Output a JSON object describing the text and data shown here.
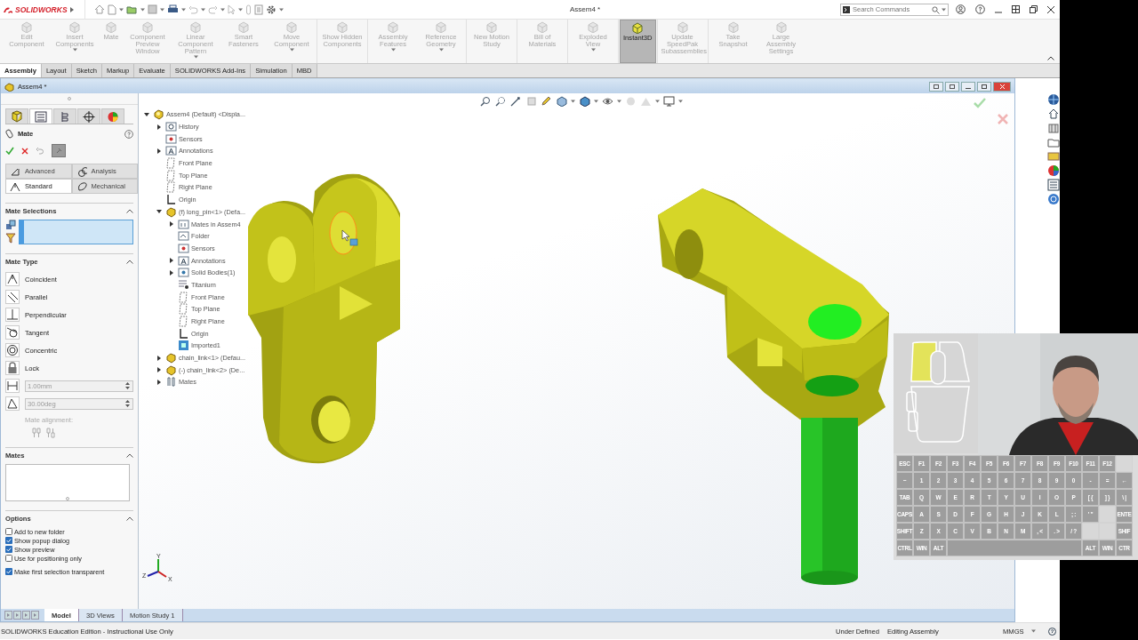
{
  "title_bar": {
    "logo": "SOLIDWORKS",
    "title": "Assem4 *",
    "search": {
      "placeholder": "Search Commands"
    }
  },
  "ribbon": [
    [
      {
        "label": "Edit Component",
        "disabled": true,
        "selected": false,
        "dropdown": false
      },
      {
        "label": "Insert Components",
        "disabled": true,
        "selected": false,
        "dropdown": true
      },
      {
        "label": "Mate",
        "disabled": true,
        "selected": false,
        "dropdown": false
      },
      {
        "label": "Component Preview Window",
        "disabled": true,
        "selected": false,
        "dropdown": false
      },
      {
        "label": "Linear Component Pattern",
        "disabled": true,
        "selected": false,
        "dropdown": true
      },
      {
        "label": "Smart Fasteners",
        "disabled": true,
        "selected": false,
        "dropdown": false
      },
      {
        "label": "Move Component",
        "disabled": true,
        "selected": false,
        "dropdown": true
      }
    ],
    [
      {
        "label": "Show Hidden Components",
        "disabled": true,
        "selected": false,
        "dropdown": false
      }
    ],
    [
      {
        "label": "Assembly Features",
        "disabled": true,
        "selected": false,
        "dropdown": true
      },
      {
        "label": "Reference Geometry",
        "disabled": true,
        "selected": false,
        "dropdown": true
      }
    ],
    [
      {
        "label": "New Motion Study",
        "disabled": true,
        "selected": false,
        "dropdown": false
      }
    ],
    [
      {
        "label": "Bill of Materials",
        "disabled": true,
        "selected": false,
        "dropdown": false
      }
    ],
    [
      {
        "label": "Exploded View",
        "disabled": true,
        "selected": false,
        "dropdown": true
      }
    ],
    [
      {
        "label": "Instant3D",
        "disabled": false,
        "selected": true,
        "dropdown": false
      }
    ],
    [
      {
        "label": "Update SpeedPak Subassemblies",
        "disabled": true,
        "selected": false,
        "dropdown": false
      }
    ],
    [
      {
        "label": "Take Snapshot",
        "disabled": true,
        "selected": false,
        "dropdown": false
      },
      {
        "label": "Large Assembly Settings",
        "disabled": true,
        "selected": false,
        "dropdown": false
      }
    ]
  ],
  "command_tabs": [
    {
      "label": "Assembly",
      "selected": true
    },
    {
      "label": "Layout",
      "selected": false
    },
    {
      "label": "Sketch",
      "selected": false
    },
    {
      "label": "Markup",
      "selected": false
    },
    {
      "label": "Evaluate",
      "selected": false
    },
    {
      "label": "SOLIDWORKS Add-Ins",
      "selected": false
    },
    {
      "label": "Simulation",
      "selected": false
    },
    {
      "label": "MBD",
      "selected": false
    }
  ],
  "document": {
    "title": "Assem4 *"
  },
  "property_manager": {
    "panel_tabs": [
      {
        "kind": "feature-tree",
        "selected": false
      },
      {
        "kind": "property",
        "selected": true
      },
      {
        "kind": "configuration",
        "selected": false
      },
      {
        "kind": "dimxpert",
        "selected": false
      },
      {
        "kind": "display",
        "selected": false
      }
    ],
    "title": "Mate",
    "mode_tabs": [
      {
        "label": "Advanced",
        "kind": "advanced",
        "selected": false
      },
      {
        "label": "Analysis",
        "kind": "analysis",
        "selected": false
      },
      {
        "label": "Standard",
        "kind": "standard",
        "selected": true
      },
      {
        "label": "Mechanical",
        "kind": "mechanical",
        "selected": false
      }
    ],
    "mate_selections": {
      "heading": "Mate Selections",
      "focused": true
    },
    "mate_type": {
      "heading": "Mate Type",
      "items": [
        {
          "label": "Coincident",
          "kind": "coincident"
        },
        {
          "label": "Parallel",
          "kind": "parallel"
        },
        {
          "label": "Perpendicular",
          "kind": "perpendicular"
        },
        {
          "label": "Tangent",
          "kind": "tangent"
        },
        {
          "label": "Concentric",
          "kind": "concentric"
        },
        {
          "label": "Lock",
          "kind": "lock"
        }
      ],
      "distance": {
        "value": "1.00mm",
        "disabled": true
      },
      "angle": {
        "value": "30.00deg",
        "disabled": true
      },
      "alignment_label": "Mate alignment:"
    },
    "mates": {
      "heading": "Mates"
    },
    "options": {
      "heading": "Options",
      "items": [
        {
          "label": "Add to new folder",
          "checked": false
        },
        {
          "label": "Show popup dialog",
          "checked": true
        },
        {
          "label": "Show preview",
          "checked": true
        },
        {
          "label": "Use for positioning only",
          "checked": false
        },
        {
          "label": "Make first selection transparent",
          "checked": true
        }
      ]
    }
  },
  "tree": [
    {
      "label": "Assem4 (Default) <Displa...",
      "kind": "assembly",
      "expanded": true,
      "children": [
        {
          "label": "History",
          "kind": "history",
          "expanded": false
        },
        {
          "label": "Sensors",
          "kind": "sensor"
        },
        {
          "label": "Annotations",
          "kind": "annotation",
          "expanded": false
        },
        {
          "label": "Front Plane",
          "kind": "plane"
        },
        {
          "label": "Top Plane",
          "kind": "plane"
        },
        {
          "label": "Right Plane",
          "kind": "plane"
        },
        {
          "label": "Origin",
          "kind": "origin"
        },
        {
          "label": "(f) long_pin<1> (Defa...",
          "kind": "part",
          "expanded": true,
          "children": [
            {
              "label": "Mates in Assem4",
              "kind": "mates-folder",
              "expanded": false
            },
            {
              "label": "Folder",
              "kind": "folder"
            },
            {
              "label": "Sensors",
              "kind": "sensor"
            },
            {
              "label": "Annotations",
              "kind": "annotation",
              "expanded": false
            },
            {
              "label": "Solid Bodies(1)",
              "kind": "body",
              "expanded": false
            },
            {
              "label": "Titanium",
              "kind": "material"
            },
            {
              "label": "Front Plane",
              "kind": "plane"
            },
            {
              "label": "Top Plane",
              "kind": "plane"
            },
            {
              "label": "Right Plane",
              "kind": "plane"
            },
            {
              "label": "Origin",
              "kind": "origin"
            },
            {
              "label": "Imported1",
              "kind": "imported"
            }
          ]
        },
        {
          "label": "chain_link<1> (Defau...",
          "kind": "part",
          "expanded": false
        },
        {
          "label": "(-) chain_link<2> (De...",
          "kind": "part",
          "expanded": false
        },
        {
          "label": "Mates",
          "kind": "mates",
          "expanded": false
        }
      ]
    }
  ],
  "triad": {
    "x": "X",
    "y": "Y",
    "z": "Z"
  },
  "bottom_tabs": [
    {
      "label": "Model",
      "selected": true
    },
    {
      "label": "3D Views",
      "selected": false
    },
    {
      "label": "Motion Study 1",
      "selected": false
    }
  ],
  "status_bar": {
    "edition": "SOLIDWORKS Education Edition - Instructional Use Only",
    "state": "Under Defined",
    "mode": "Editing Assembly",
    "units": "MMGS"
  },
  "overlay": {
    "mouse": {
      "left_pressed": true,
      "right_pressed": false
    },
    "keyboard": [
      [
        {
          "label": "ESC"
        },
        {
          "label": "F1"
        },
        {
          "label": "F2"
        },
        {
          "label": "F3"
        },
        {
          "label": "F4"
        },
        {
          "label": "F5"
        },
        {
          "label": "F6"
        },
        {
          "label": "F7"
        },
        {
          "label": "F8"
        },
        {
          "label": "F9"
        },
        {
          "label": "F10"
        },
        {
          "label": "F11"
        },
        {
          "label": "F12"
        },
        {
          "kind": "blank"
        }
      ],
      [
        {
          "label": "~"
        },
        {
          "label": "1"
        },
        {
          "label": "2"
        },
        {
          "label": "3"
        },
        {
          "label": "4"
        },
        {
          "label": "5"
        },
        {
          "label": "6"
        },
        {
          "label": "7"
        },
        {
          "label": "8"
        },
        {
          "label": "9"
        },
        {
          "label": "0"
        },
        {
          "label": "-"
        },
        {
          "label": "="
        },
        {
          "label": "←"
        }
      ],
      [
        {
          "label": "TAB"
        },
        {
          "label": "Q"
        },
        {
          "label": "W"
        },
        {
          "label": "E"
        },
        {
          "label": "R"
        },
        {
          "label": "T"
        },
        {
          "label": "Y"
        },
        {
          "label": "U"
        },
        {
          "label": "I"
        },
        {
          "label": "O"
        },
        {
          "label": "P"
        },
        {
          "label": "[ {"
        },
        {
          "label": "] }"
        },
        {
          "label": "\\ |"
        }
      ],
      [
        {
          "label": "CAPS"
        },
        {
          "label": "A"
        },
        {
          "label": "S"
        },
        {
          "label": "D"
        },
        {
          "label": "F"
        },
        {
          "label": "G"
        },
        {
          "label": "H"
        },
        {
          "label": "J"
        },
        {
          "label": "K"
        },
        {
          "label": "L"
        },
        {
          "label": "; :"
        },
        {
          "label": "' \""
        },
        {
          "kind": "blank"
        },
        {
          "label": "ENTE"
        }
      ],
      [
        {
          "label": "SHIFT"
        },
        {
          "label": "Z"
        },
        {
          "label": "X"
        },
        {
          "label": "C"
        },
        {
          "label": "V"
        },
        {
          "label": "B"
        },
        {
          "label": "N"
        },
        {
          "label": "M"
        },
        {
          "label": ", <"
        },
        {
          "label": ". >"
        },
        {
          "label": "/ ?"
        },
        {
          "kind": "blank"
        },
        {
          "kind": "blank"
        },
        {
          "label": "SHIF"
        }
      ],
      [
        {
          "label": "CTRL"
        },
        {
          "label": "WIN"
        },
        {
          "label": "ALT"
        },
        {
          "kind": "space"
        },
        {
          "label": "ALT"
        },
        {
          "label": "WIN"
        },
        {
          "label": "CTR"
        }
      ]
    ]
  }
}
